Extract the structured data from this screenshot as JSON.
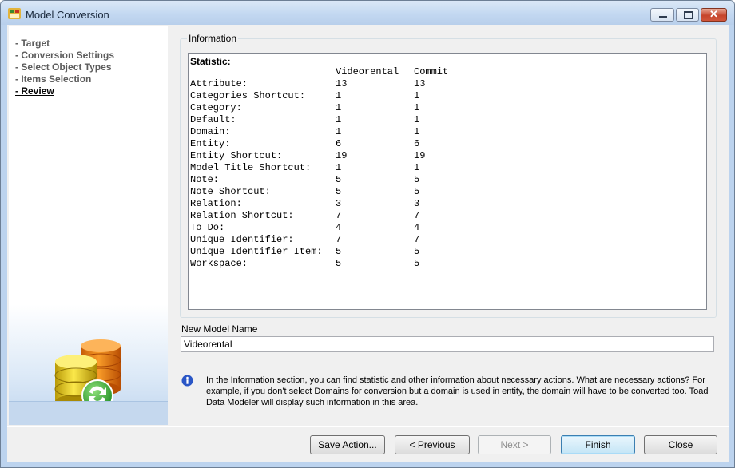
{
  "window": {
    "title": "Model Conversion"
  },
  "steps": [
    "- Target",
    "- Conversion Settings",
    "- Select Object Types",
    "- Items Selection",
    "- Review"
  ],
  "active_step": 4,
  "information": {
    "caption": "Information",
    "statistic_label": "Statistic:",
    "columns": [
      "",
      "Videorental",
      "Commit"
    ],
    "rows": [
      [
        "Attribute:",
        "13",
        "13"
      ],
      [
        "Categories Shortcut:",
        "1",
        "1"
      ],
      [
        "Category:",
        "1",
        "1"
      ],
      [
        "Default:",
        "1",
        "1"
      ],
      [
        "Domain:",
        "1",
        "1"
      ],
      [
        "Entity:",
        "6",
        "6"
      ],
      [
        "Entity Shortcut:",
        "19",
        "19"
      ],
      [
        "Model Title Shortcut:",
        "1",
        "1"
      ],
      [
        "Note:",
        "5",
        "5"
      ],
      [
        "Note Shortcut:",
        "5",
        "5"
      ],
      [
        "Relation:",
        "3",
        "3"
      ],
      [
        "Relation Shortcut:",
        "7",
        "7"
      ],
      [
        "To Do:",
        "4",
        "4"
      ],
      [
        "Unique Identifier:",
        "7",
        "7"
      ],
      [
        "Unique Identifier Item:",
        "5",
        "5"
      ],
      [
        "Workspace:",
        "5",
        "5"
      ]
    ]
  },
  "model_name": {
    "label": "New Model Name",
    "value": "Videorental"
  },
  "help_text": "In the Information section, you can find statistic and other information about necessary actions. What are necessary actions? For example, if you don't select Domains for conversion but a domain is used in entity, the domain will have to be converted too. Toad Data Modeler will display such information in this area.",
  "buttons": {
    "save_action": "Save Action...",
    "previous": "< Previous",
    "next": "Next >",
    "finish": "Finish",
    "close": "Close"
  },
  "colors": {
    "accent": "#3c7fb1",
    "sidebar_gradient": "#bfd5ee"
  }
}
